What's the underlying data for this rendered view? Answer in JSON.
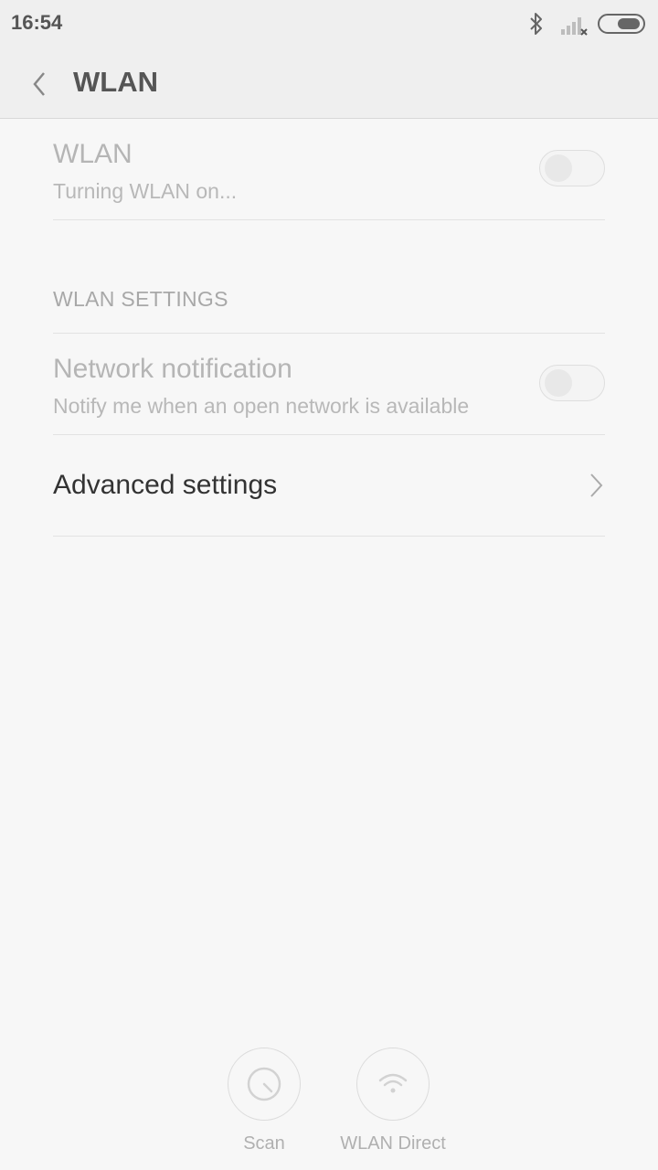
{
  "status_bar": {
    "time": "16:54"
  },
  "header": {
    "title": "WLAN"
  },
  "wlan_row": {
    "title": "WLAN",
    "subtitle": "Turning WLAN on...",
    "toggle_on": false
  },
  "wlan_settings": {
    "section_label": "WLAN SETTINGS",
    "network_notification": {
      "title": "Network notification",
      "subtitle": "Notify me when an open network is available",
      "toggle_on": false
    },
    "advanced_settings": {
      "title": "Advanced settings"
    }
  },
  "bottom_actions": [
    {
      "label": "Scan",
      "icon": "scan-icon"
    },
    {
      "label": "WLAN Direct",
      "icon": "wlan-direct-icon"
    }
  ]
}
